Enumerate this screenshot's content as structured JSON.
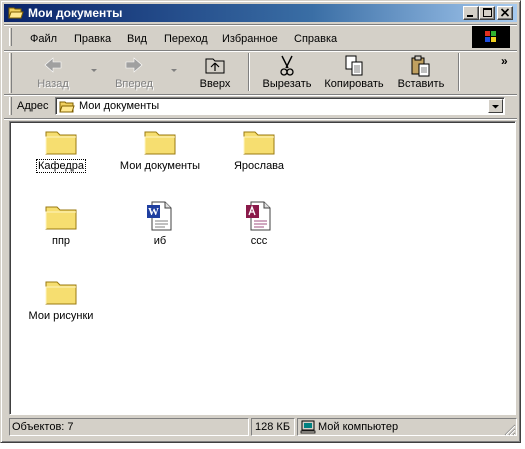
{
  "window": {
    "title": "Мои документы",
    "colors": {
      "titlebar_active": "#0a246a",
      "face": "#d4d0c8"
    }
  },
  "menu": [
    "Файл",
    "Правка",
    "Вид",
    "Переход",
    "Избранное",
    "Справка"
  ],
  "toolbar": {
    "back": "Назад",
    "forward": "Вперед",
    "up": "Вверх",
    "cut": "Вырезать",
    "copy": "Копировать",
    "paste": "Вставить",
    "overflow": "»"
  },
  "address": {
    "label": "Адрес",
    "value": "Мои документы"
  },
  "items": [
    {
      "name": "Кафедра",
      "icon": "folder-icon"
    },
    {
      "name": "Мои документы",
      "icon": "folder-icon"
    },
    {
      "name": "Ярослава",
      "icon": "folder-icon"
    },
    {
      "name": "ппр",
      "icon": "folder-icon"
    },
    {
      "name": "иб",
      "icon": "word-document-icon"
    },
    {
      "name": "ссс",
      "icon": "access-document-icon"
    },
    {
      "name": "Мои рисунки",
      "icon": "folder-icon"
    }
  ],
  "status": {
    "objects": "Объектов: 7",
    "size": "128 КБ",
    "location": "Мой компьютер"
  }
}
